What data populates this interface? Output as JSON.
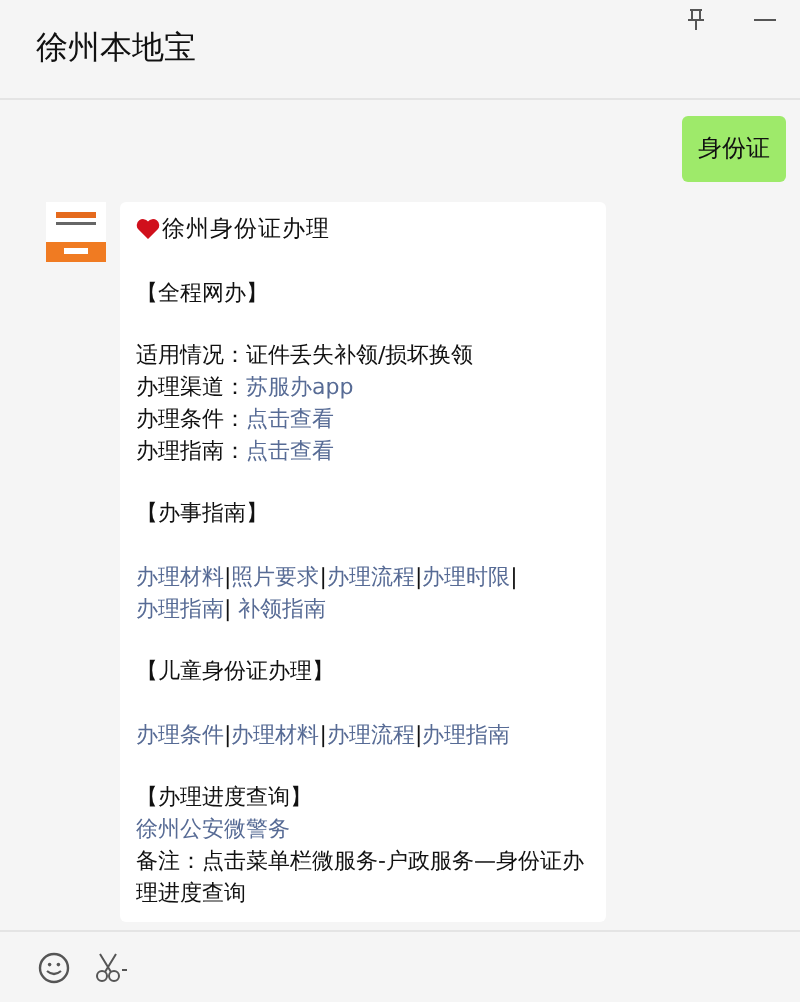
{
  "window": {
    "title": "徐州本地宝"
  },
  "messages": [
    {
      "kind": "sent",
      "text": "身份证"
    },
    {
      "kind": "received",
      "title": "徐州身份证办理",
      "paragraphs": [
        {
          "space_before": true,
          "segments": [
            {
              "text": "【全程网办】",
              "link": false
            }
          ]
        },
        {
          "space_before": true,
          "segments": [
            {
              "text": "适用情况：证件丢失补领/损坏换领",
              "link": false
            }
          ]
        },
        {
          "space_before": false,
          "segments": [
            {
              "text": "办理渠道：",
              "link": false
            },
            {
              "text": "苏服办app",
              "link": true
            }
          ]
        },
        {
          "space_before": false,
          "segments": [
            {
              "text": "办理条件：",
              "link": false
            },
            {
              "text": "点击查看",
              "link": true
            }
          ]
        },
        {
          "space_before": false,
          "segments": [
            {
              "text": "办理指南：",
              "link": false
            },
            {
              "text": "点击查看",
              "link": true
            }
          ]
        },
        {
          "space_before": true,
          "segments": [
            {
              "text": "【办事指南】",
              "link": false
            }
          ]
        },
        {
          "space_before": true,
          "segments": [
            {
              "text": "办理材料",
              "link": true
            },
            {
              "text": "|",
              "link": false
            },
            {
              "text": "照片要求",
              "link": true
            },
            {
              "text": "|",
              "link": false
            },
            {
              "text": "办理流程",
              "link": true
            },
            {
              "text": "|",
              "link": false
            },
            {
              "text": "办理时限",
              "link": true
            },
            {
              "text": "|",
              "link": false
            },
            {
              "text": "办理指南",
              "link": true
            },
            {
              "text": "|",
              "link": false
            },
            {
              "text": " 补领指南",
              "link": true
            }
          ]
        },
        {
          "space_before": true,
          "segments": [
            {
              "text": "【儿童身份证办理】",
              "link": false
            }
          ]
        },
        {
          "space_before": true,
          "segments": [
            {
              "text": "办理条件",
              "link": true
            },
            {
              "text": "|",
              "link": false
            },
            {
              "text": "办理材料",
              "link": true
            },
            {
              "text": "|",
              "link": false
            },
            {
              "text": "办理流程",
              "link": true
            },
            {
              "text": "|",
              "link": false
            },
            {
              "text": "办理指南",
              "link": true
            }
          ]
        },
        {
          "space_before": true,
          "segments": [
            {
              "text": "【办理进度查询】",
              "link": false
            }
          ]
        },
        {
          "space_before": false,
          "segments": [
            {
              "text": "徐州公安微警务",
              "link": true
            }
          ]
        },
        {
          "space_before": false,
          "segments": [
            {
              "text": "备注：点击菜单栏微服务-户政服务—身份证办理进度查询",
              "link": false
            }
          ]
        }
      ]
    }
  ]
}
